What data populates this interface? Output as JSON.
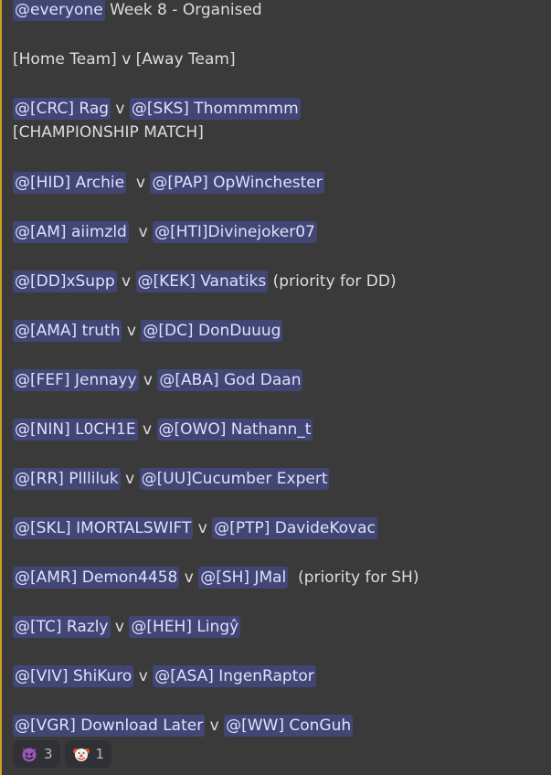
{
  "message": {
    "header": {
      "mention": "@everyone",
      "text": " Week 8 - Organised"
    },
    "format_line": "[Home Team] v [Away Team]",
    "matches": [
      {
        "home": "@[CRC] Rag",
        "sep": " v ",
        "away": "@[SKS] Thommmmm",
        "note": ""
      },
      {
        "home": "@[HID] Archie",
        "sep": "  v ",
        "away": "@[PAP] OpWinchester",
        "note": ""
      },
      {
        "home": "@[AM] aiimzld",
        "sep": "  v ",
        "away": "@[HTI]Divinejoker07",
        "note": ""
      },
      {
        "home": "@[DD]xSupp",
        "sep": " v ",
        "away": "@[KEK] Vanatiks",
        "note": " (priority for DD)"
      },
      {
        "home": "@[AMA] truth",
        "sep": " v ",
        "away": "@[DC] DonDuuug",
        "note": ""
      },
      {
        "home": "@[FEF] Jennayy",
        "sep": " v ",
        "away": "@[ABA] God Daan",
        "note": ""
      },
      {
        "home": "@[NIN] L0CH1E",
        "sep": " v ",
        "away": "@[OWO] Nathann_t",
        "note": ""
      },
      {
        "home": "@[RR] Pllliluk",
        "sep": " v ",
        "away": "@[UU]Cucumber Expert",
        "note": ""
      },
      {
        "home": "@[SKL] IMORTALSWIFT",
        "sep": " v ",
        "away": "@[PTP] DavideKovac",
        "note": ""
      },
      {
        "home": "@[AMR] Demon4458",
        "sep": " v ",
        "away": "@[SH] JMal",
        "note": "  (priority for SH)"
      },
      {
        "home": "@[TC] Razly",
        "sep": " v ",
        "away": "@[HEH] Lingŷ",
        "note": ""
      },
      {
        "home": "@[VIV] ShiKuro",
        "sep": " v ",
        "away": "@[ASA] IngenRaptor",
        "note": ""
      },
      {
        "home": "@[VGR] Download Later",
        "sep": " v ",
        "away": "@[WW] ConGuh",
        "note": ""
      }
    ],
    "championship_label": "[CHAMPIONSHIP MATCH]"
  },
  "reactions": [
    {
      "emoji": "smiling-imp-emoji",
      "count": "3"
    },
    {
      "emoji": "clown-face-emoji",
      "count": "1"
    }
  ],
  "colors": {
    "background": "#3a3a3a",
    "mention_bg": "#414675",
    "mention_text": "#dee0fc",
    "text": "#dcddde",
    "reaction_bg": "#2f3136",
    "highlight_bar": "#c9a227"
  }
}
